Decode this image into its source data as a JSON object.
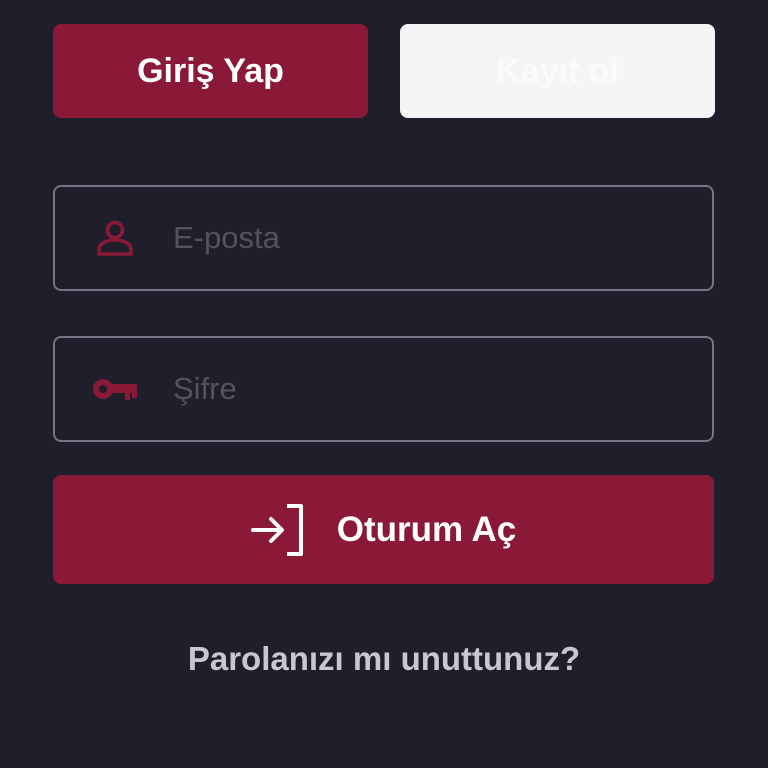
{
  "tabs": {
    "login_label": "Giriş Yap",
    "register_label": "Kayıt ol"
  },
  "email_field": {
    "placeholder": "E-posta",
    "value": "",
    "icon": "person-icon"
  },
  "password_field": {
    "placeholder": "Şifre",
    "value": "",
    "icon": "key-icon"
  },
  "submit": {
    "label": "Oturum Aç",
    "icon": "login-arrow-icon"
  },
  "forgot_password": {
    "label": "Parolanızı mı unuttunuz?"
  },
  "colors": {
    "background": "#1f1e2b",
    "accent": "#8a1837",
    "inactive_tab": "#f7f4f8",
    "field_border": "#757482",
    "placeholder": "#54525f",
    "link": "#c8c6d1"
  }
}
